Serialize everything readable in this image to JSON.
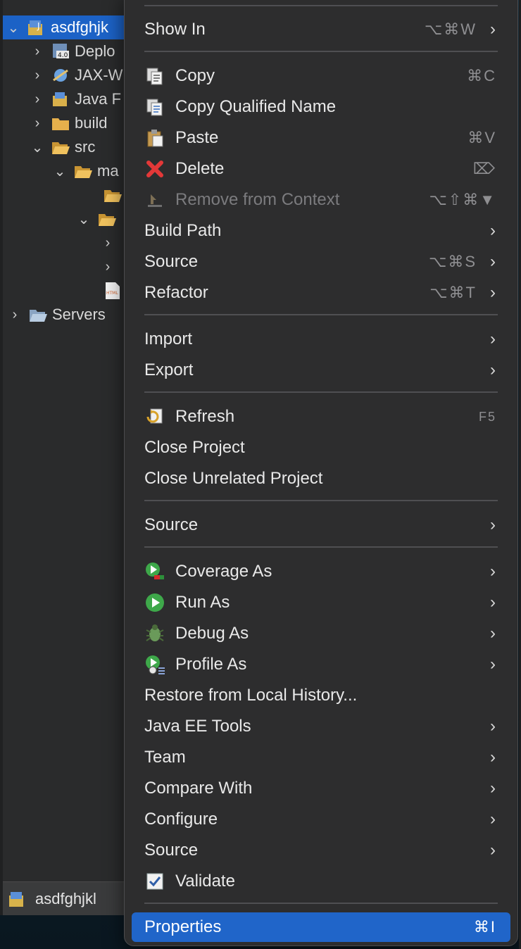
{
  "explorer": {
    "rows": [
      {
        "label": "asdfghjk",
        "icon": "project-icon"
      },
      {
        "label": "Deplo",
        "icon": "deployment-descriptor-icon"
      },
      {
        "label": "JAX-W",
        "icon": "web-services-icon"
      },
      {
        "label": "Java F",
        "icon": "java-resources-icon"
      },
      {
        "label": "build",
        "icon": "folder-icon"
      },
      {
        "label": "src",
        "icon": "folder-open-icon"
      },
      {
        "label": "ma",
        "icon": "folder-open-icon"
      },
      {
        "label": "",
        "icon": "folder-icon"
      },
      {
        "label": "",
        "icon": "folder-open-icon"
      },
      {
        "label": "",
        "icon": "chevron-right-icon"
      },
      {
        "label": "",
        "icon": "chevron-right-icon"
      },
      {
        "label": "",
        "icon": "html-file-icon"
      },
      {
        "label": "Servers",
        "icon": "servers-folder-icon"
      }
    ],
    "bottom_project": "asdfghjkl"
  },
  "menu": {
    "show_in": {
      "label": "Show In",
      "shortcut": "⌥⌘W"
    },
    "copy": {
      "label": "Copy",
      "shortcut": "⌘C"
    },
    "copy_qualified": {
      "label": "Copy Qualified Name"
    },
    "paste": {
      "label": "Paste",
      "shortcut": "⌘V"
    },
    "delete": {
      "label": "Delete",
      "shortcut": "⌦"
    },
    "remove_context": {
      "label": "Remove from Context",
      "shortcut": "⌥⇧⌘▼"
    },
    "build_path": {
      "label": "Build Path"
    },
    "source1": {
      "label": "Source",
      "shortcut": "⌥⌘S"
    },
    "refactor": {
      "label": "Refactor",
      "shortcut": "⌥⌘T"
    },
    "import": {
      "label": "Import"
    },
    "export": {
      "label": "Export"
    },
    "refresh": {
      "label": "Refresh",
      "shortcut": "F5"
    },
    "close_project": {
      "label": "Close Project"
    },
    "close_unrelated": {
      "label": "Close Unrelated Project"
    },
    "source2": {
      "label": "Source"
    },
    "coverage_as": {
      "label": "Coverage As"
    },
    "run_as": {
      "label": "Run As"
    },
    "debug_as": {
      "label": "Debug As"
    },
    "profile_as": {
      "label": "Profile As"
    },
    "restore_history": {
      "label": "Restore from Local History..."
    },
    "javaee_tools": {
      "label": "Java EE Tools"
    },
    "team": {
      "label": "Team"
    },
    "compare_with": {
      "label": "Compare With"
    },
    "configure": {
      "label": "Configure"
    },
    "source3": {
      "label": "Source"
    },
    "validate": {
      "label": "Validate"
    },
    "properties": {
      "label": "Properties",
      "shortcut": "⌘I"
    }
  },
  "colors": {
    "selection": "#2065c9",
    "menu_bg": "#2d2d2e"
  }
}
